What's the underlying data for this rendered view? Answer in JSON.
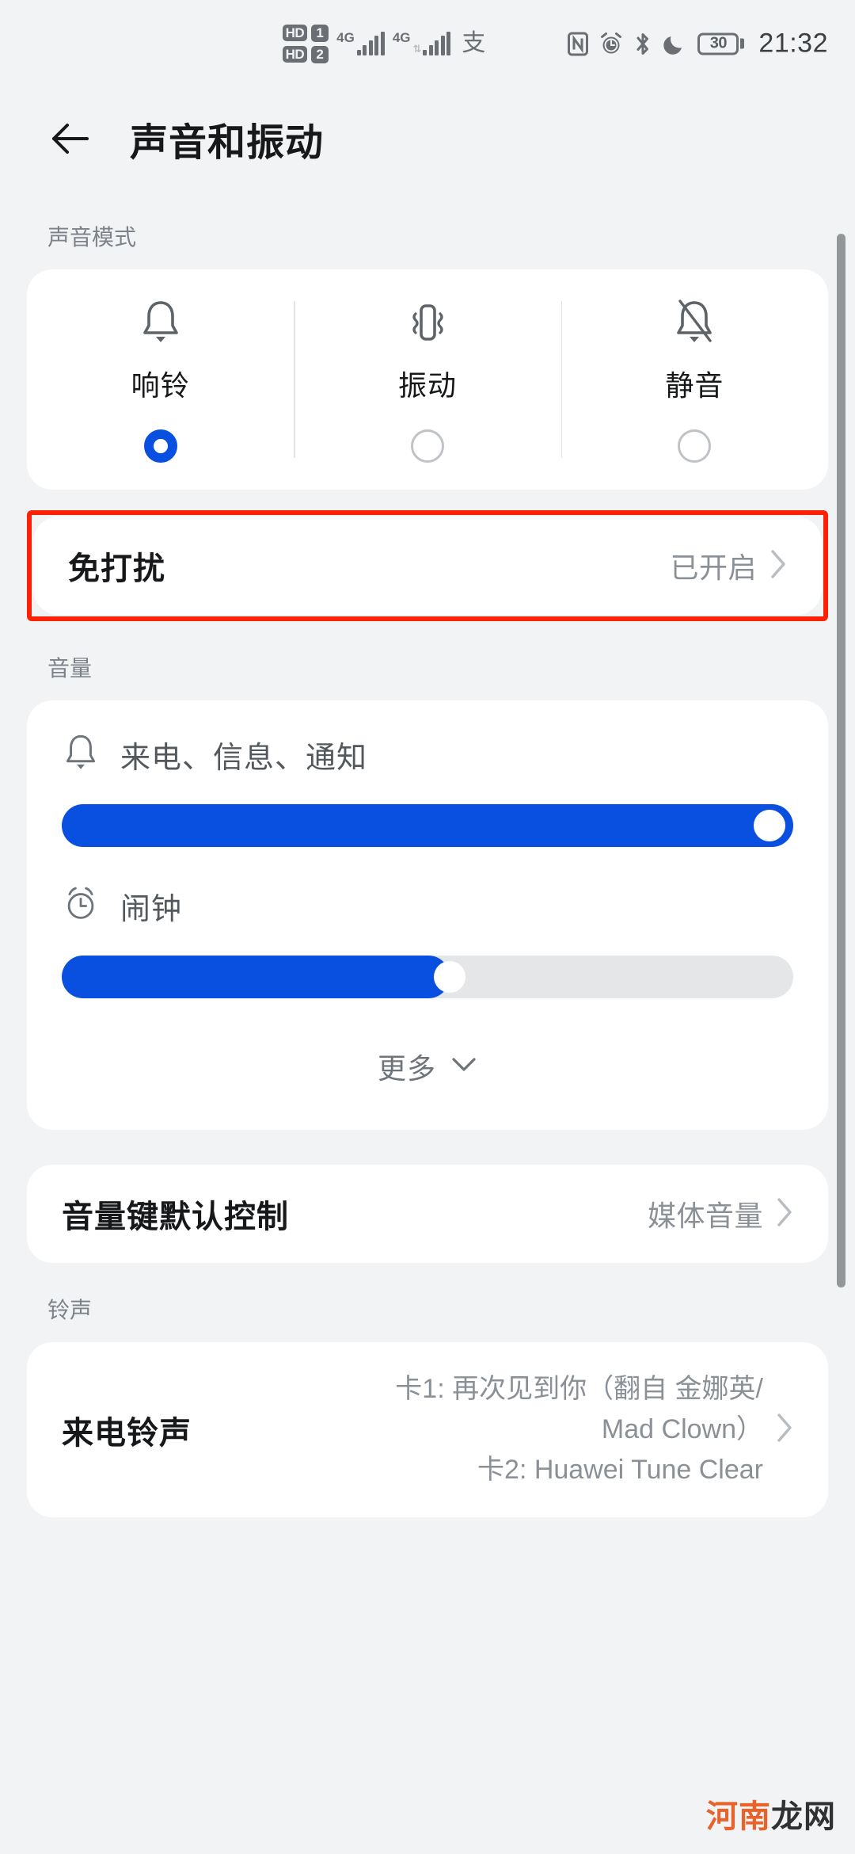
{
  "status_bar": {
    "hd_labels": [
      "HD",
      "HD"
    ],
    "sim_numbers": [
      "1",
      "2"
    ],
    "network_sim1": "4G",
    "network_sim2": "4G",
    "ime_indicator": "支",
    "icons": [
      "nfc-icon",
      "alarm-icon",
      "bluetooth-icon",
      "do-not-disturb-moon-icon"
    ],
    "battery_level": "30",
    "time": "21:32"
  },
  "header": {
    "back_icon": "back-arrow-icon",
    "title": "声音和振动"
  },
  "sound_mode": {
    "section_label": "声音模式",
    "options": [
      {
        "label": "响铃",
        "icon": "bell-icon",
        "selected": true
      },
      {
        "label": "振动",
        "icon": "vibrate-icon",
        "selected": false
      },
      {
        "label": "静音",
        "icon": "bell-slash-icon",
        "selected": false
      }
    ]
  },
  "dnd": {
    "title": "免打扰",
    "value": "已开启",
    "chevron": "chevron-right-icon",
    "highlight_color": "#fb2207"
  },
  "volume": {
    "section_label": "音量",
    "sliders": [
      {
        "icon": "bell-icon",
        "label": "来电、信息、通知",
        "percent": 100
      },
      {
        "icon": "alarm-clock-icon",
        "label": "闹钟",
        "percent": 53
      }
    ],
    "more_label": "更多",
    "more_icon": "chevron-down-icon",
    "accent_color": "#0a50e0",
    "track_color": "#e4e6e8"
  },
  "volume_key": {
    "title": "音量键默认控制",
    "value": "媒体音量",
    "chevron": "chevron-right-icon"
  },
  "ringtone": {
    "section_label": "铃声",
    "title": "来电铃声",
    "value_line1": "卡1: 再次见到你（翻自 金娜英/",
    "value_line2": "Mad Clown）",
    "value_line3": "卡2: Huawei Tune Clear",
    "chevron": "chevron-right-icon"
  },
  "watermark": {
    "part1": "河南",
    "part2": "龙网"
  }
}
